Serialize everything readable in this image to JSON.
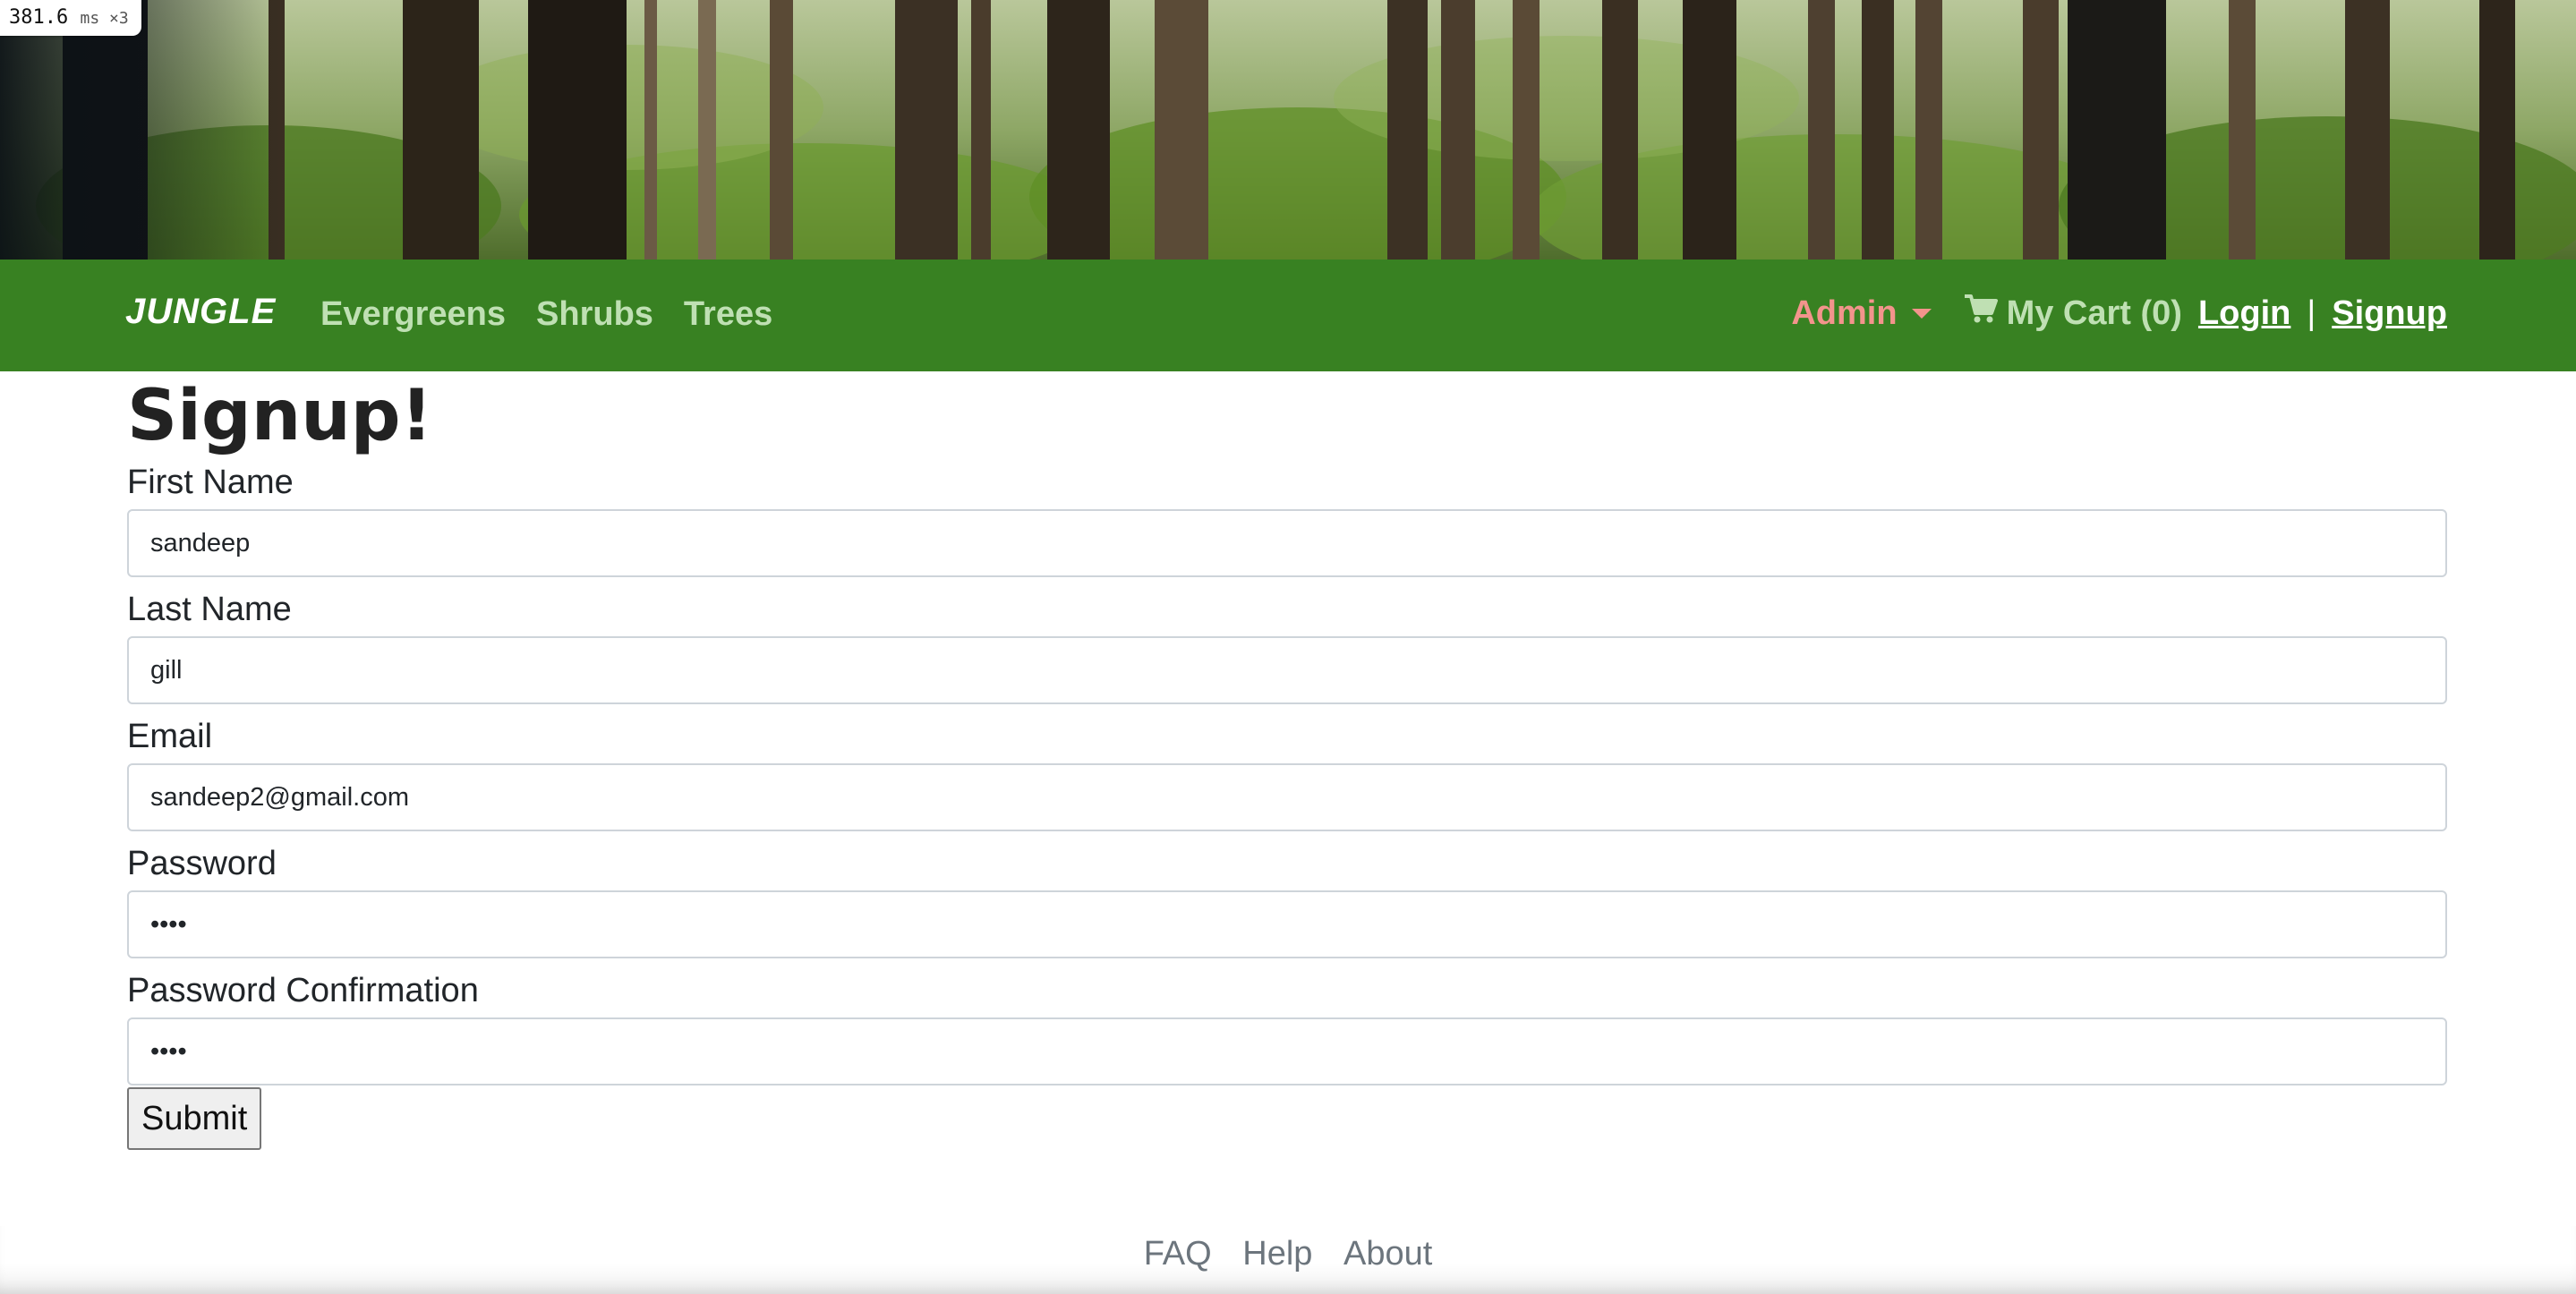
{
  "perf": {
    "value": "381.6",
    "unit": "ms ×3"
  },
  "navbar": {
    "brand": "JUNGLE",
    "links": [
      "Evergreens",
      "Shrubs",
      "Trees"
    ],
    "admin_label": "Admin",
    "cart_label": "My Cart (0)",
    "login_label": "Login",
    "separator": "|",
    "signup_label": "Signup"
  },
  "page": {
    "title": "Signup!"
  },
  "form": {
    "fields": [
      {
        "label": "First Name",
        "value": "sandeep",
        "type": "text"
      },
      {
        "label": "Last Name",
        "value": "gill",
        "type": "text"
      },
      {
        "label": "Email",
        "value": "sandeep2@gmail.com",
        "type": "email"
      },
      {
        "label": "Password",
        "value": "••••",
        "type": "password"
      },
      {
        "label": "Password Confirmation",
        "value": "••••",
        "type": "password"
      }
    ],
    "submit_label": "Submit"
  },
  "footer": {
    "links": [
      "FAQ",
      "Help",
      "About"
    ]
  },
  "colors": {
    "navbar_bg": "#388122",
    "nav_link": "#bfe0b3",
    "admin": "#f3948c",
    "auth_link": "#ffffff"
  },
  "icons": {
    "cart": "shopping-cart-icon",
    "admin_dropdown": "caret-down-icon"
  }
}
